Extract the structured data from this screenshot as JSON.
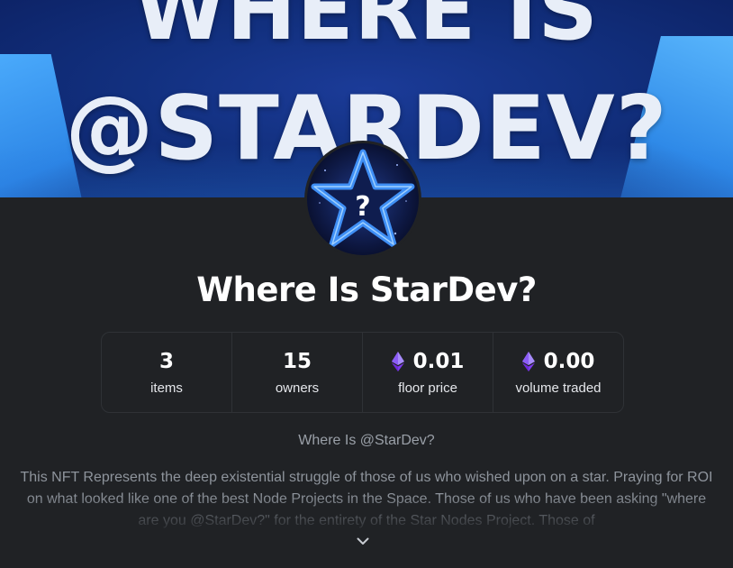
{
  "banner": {
    "line1": "WHERE IS",
    "line2": "@STARDEV?"
  },
  "avatar": {
    "icon": "star-question-icon",
    "glyph": "?"
  },
  "collection": {
    "title": "Where Is StarDev?",
    "subtitle": "Where Is @StarDev?",
    "description": "This NFT Represents the deep existential struggle of those of us who wished upon on a star. Praying for ROI on what looked like one of the best Node Projects in the Space. Those of us who have been asking \"where are you @StarDev?\" for the entirety of the Star Nodes Project. Those of"
  },
  "stats": [
    {
      "value": "3",
      "label": "items",
      "icon": null
    },
    {
      "value": "15",
      "label": "owners",
      "icon": null
    },
    {
      "value": "0.01",
      "label": "floor price",
      "icon": "ethereum-icon"
    },
    {
      "value": "0.00",
      "label": "volume traded",
      "icon": "ethereum-icon"
    }
  ],
  "expand": {
    "icon": "chevron-down-icon"
  },
  "colors": {
    "background": "#202225",
    "eth": "#8a5cf6",
    "banner": "#12307f"
  }
}
